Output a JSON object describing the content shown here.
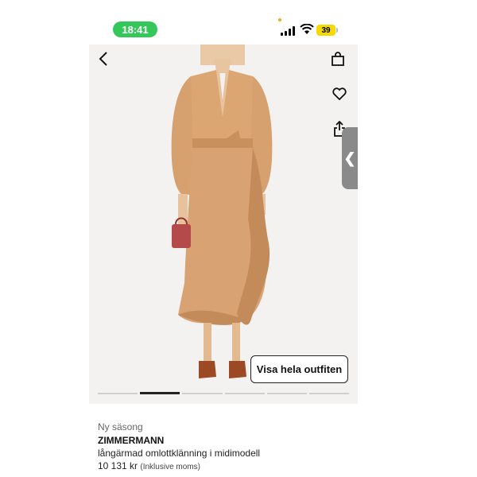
{
  "status_bar": {
    "time": "18:41",
    "battery": "39",
    "icons": [
      "signal-icon",
      "wifi-icon",
      "battery-icon"
    ]
  },
  "product_image": {
    "description_icon": "dress-photo",
    "icons": {
      "back": "chevron-left-icon",
      "bag": "shopping-bag-icon",
      "wishlist": "heart-icon",
      "share": "share-icon",
      "side_tab": "chevron-left-icon"
    },
    "outfit_button": "Visa hela outfiten",
    "pager": {
      "count": 6,
      "active_index": 1
    }
  },
  "product": {
    "badge": "Ny säsong",
    "brand": "ZIMMERMANN",
    "name": "långärmad omlottklänning i midimodell",
    "price": "10 131 kr",
    "price_note": "(Inklusive moms)"
  },
  "colors": {
    "time_pill": "#34c759",
    "battery": "#f5d900",
    "dress": "#d9a273",
    "image_bg": "#f3f2f1"
  }
}
